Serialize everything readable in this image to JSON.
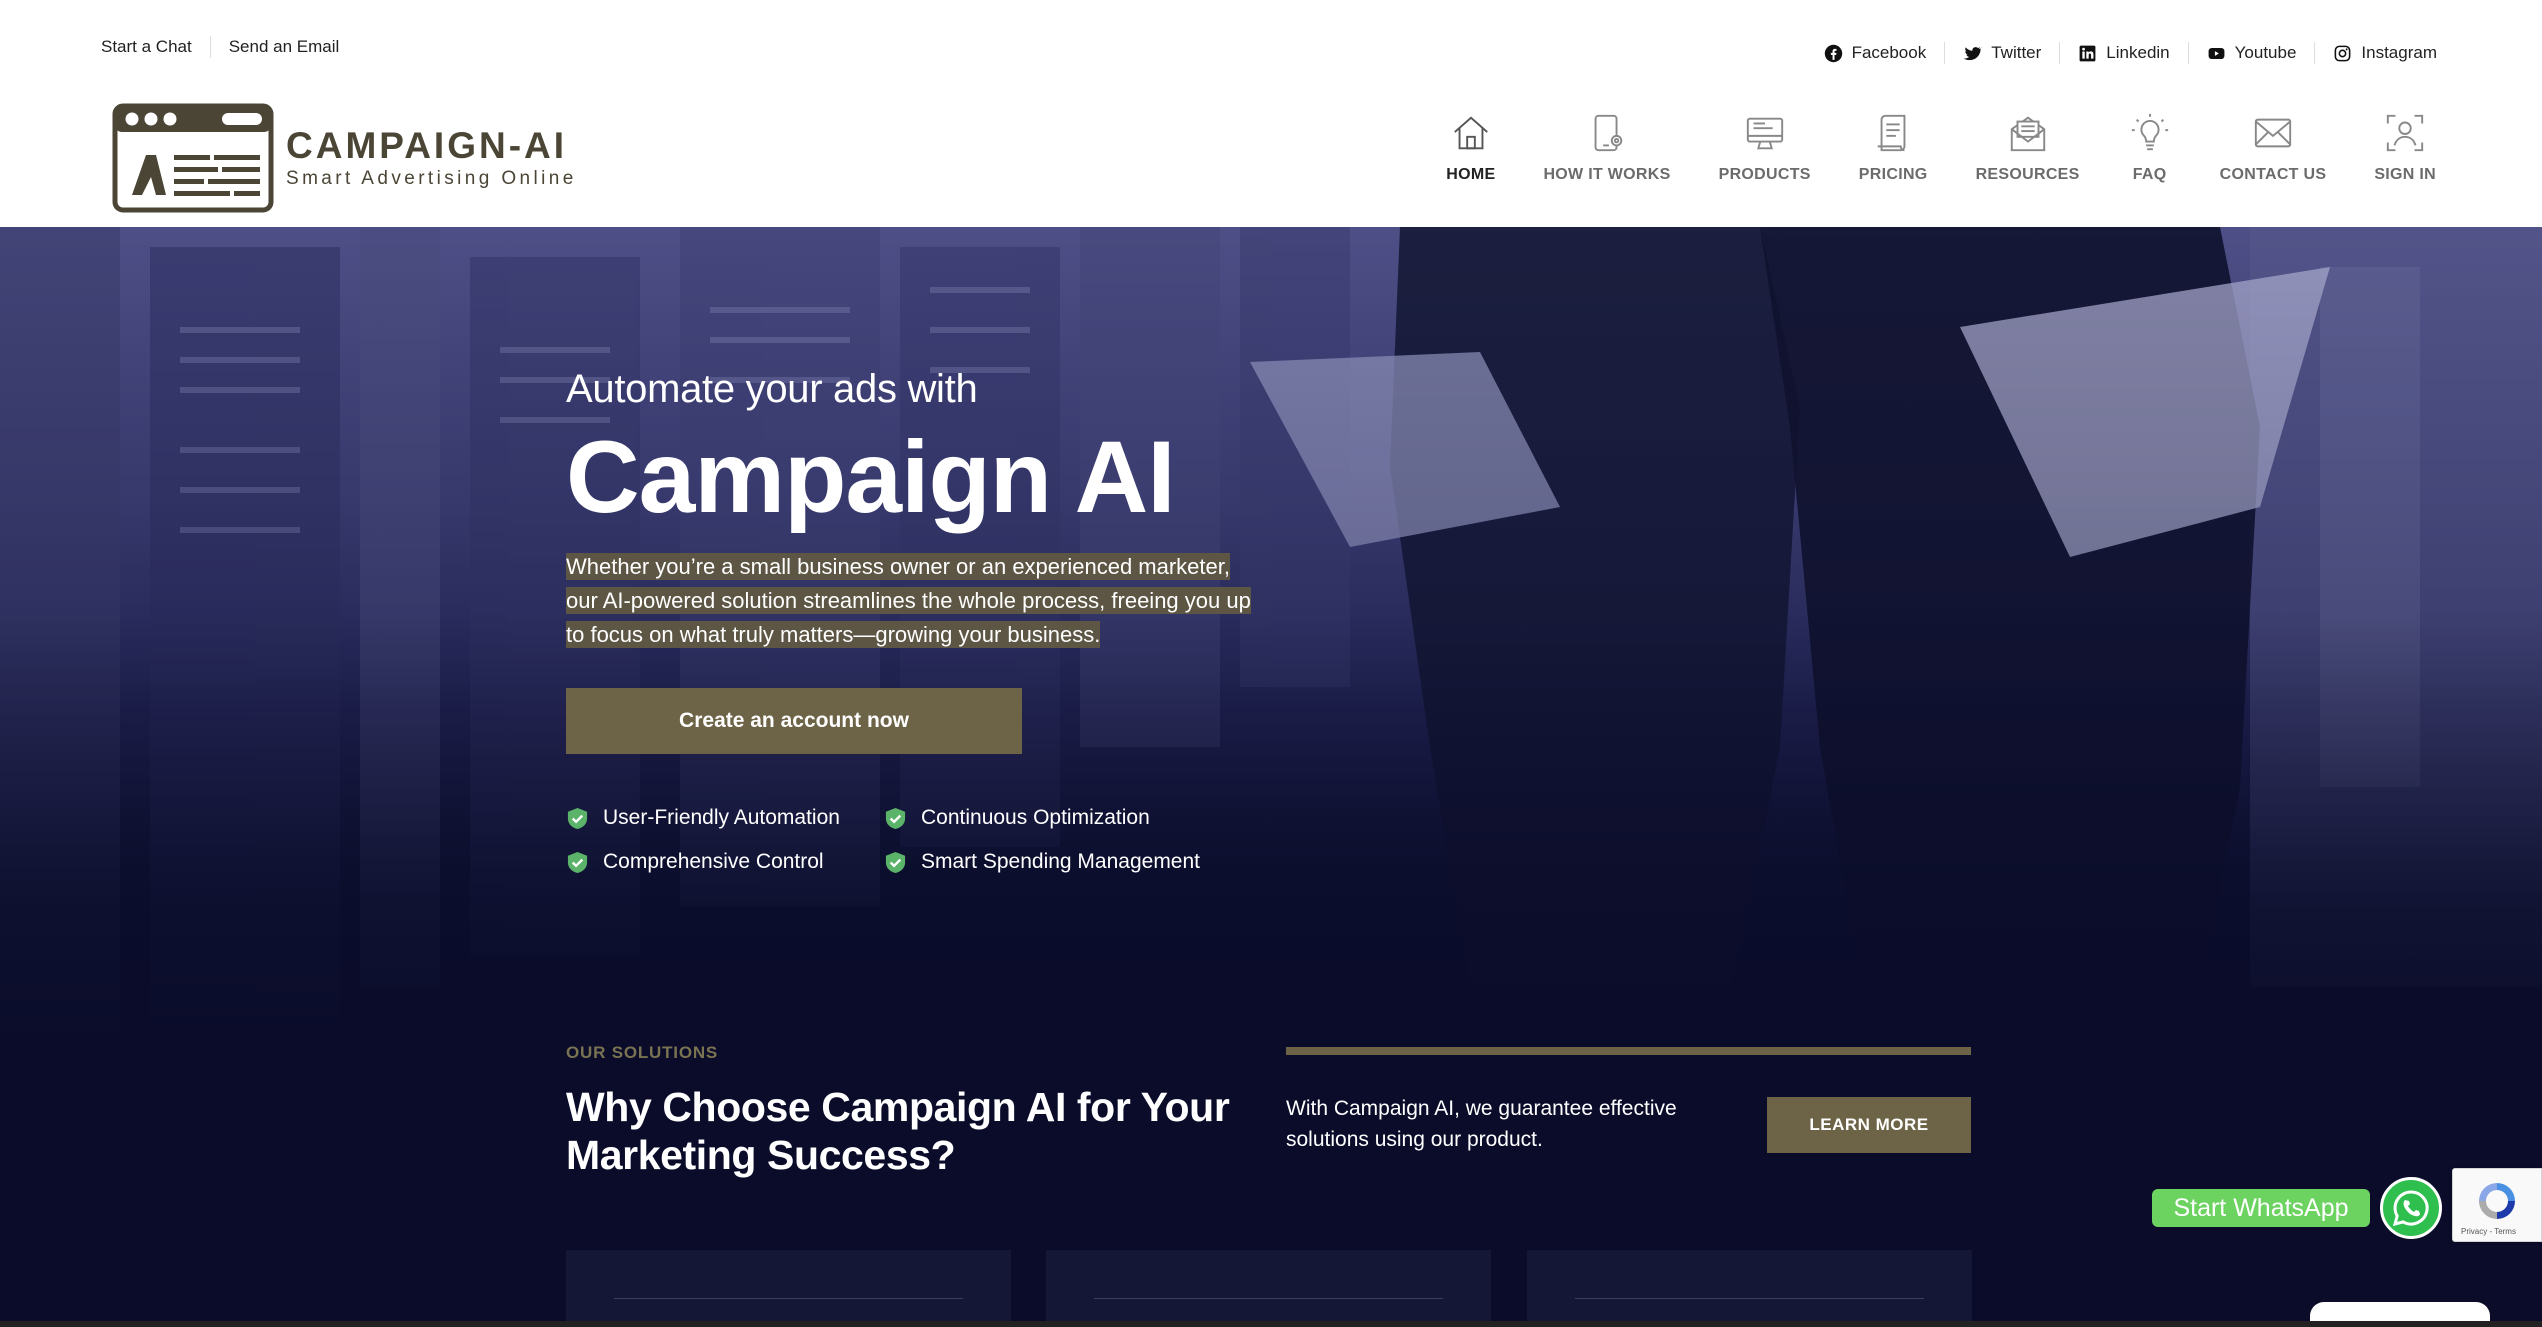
{
  "topbar": {
    "links": [
      "Start a Chat",
      "Send an Email"
    ]
  },
  "social": [
    {
      "icon": "facebook-icon",
      "label": "Facebook"
    },
    {
      "icon": "twitter-icon",
      "label": "Twitter"
    },
    {
      "icon": "linkedin-icon",
      "label": "Linkedin"
    },
    {
      "icon": "youtube-icon",
      "label": "Youtube"
    },
    {
      "icon": "instagram-icon",
      "label": "Instagram"
    }
  ],
  "logo": {
    "name": "CAMPAIGN-AI",
    "tagline": "Smart Advertising Online"
  },
  "nav": [
    {
      "icon": "home-icon",
      "label": "HOME",
      "active": true
    },
    {
      "icon": "tablet-gear-icon",
      "label": "HOW IT WORKS",
      "active": false
    },
    {
      "icon": "monitor-icon",
      "label": "PRODUCTS",
      "active": false
    },
    {
      "icon": "document-icon",
      "label": "PRICING",
      "active": false
    },
    {
      "icon": "mail-open-icon",
      "label": "RESOURCES",
      "active": false
    },
    {
      "icon": "lightbulb-icon",
      "label": "FAQ",
      "active": false
    },
    {
      "icon": "envelope-icon",
      "label": "CONTACT US",
      "active": false
    },
    {
      "icon": "user-scan-icon",
      "label": "SIGN IN",
      "active": false
    }
  ],
  "hero": {
    "subtitle": "Automate your ads with",
    "title": "Campaign AI",
    "description": "Whether you’re a small business owner or an experienced marketer, our AI-powered solution streamlines the whole process, freeing you up to focus on what truly matters—growing your business.",
    "cta": "Create an account now",
    "features": [
      "User-Friendly Automation",
      "Continuous Optimization",
      "Comprehensive Control",
      "Smart Spending Management"
    ]
  },
  "solutions": {
    "label": "OUR SOLUTIONS",
    "title": "Why Choose Campaign AI for Your Marketing Success?",
    "text": "With Campaign AI, we guarantee effective solutions using our product.",
    "button": "LEARN MORE"
  },
  "whatsapp": {
    "label": "Start WhatsApp"
  },
  "recaptcha": {
    "links": "Privacy - Terms"
  },
  "colors": {
    "accent": "#6d6447",
    "hero_bg": "#0a0c2a",
    "whatsapp": "#6cd260",
    "card_tab_orange": "#b35a26"
  }
}
